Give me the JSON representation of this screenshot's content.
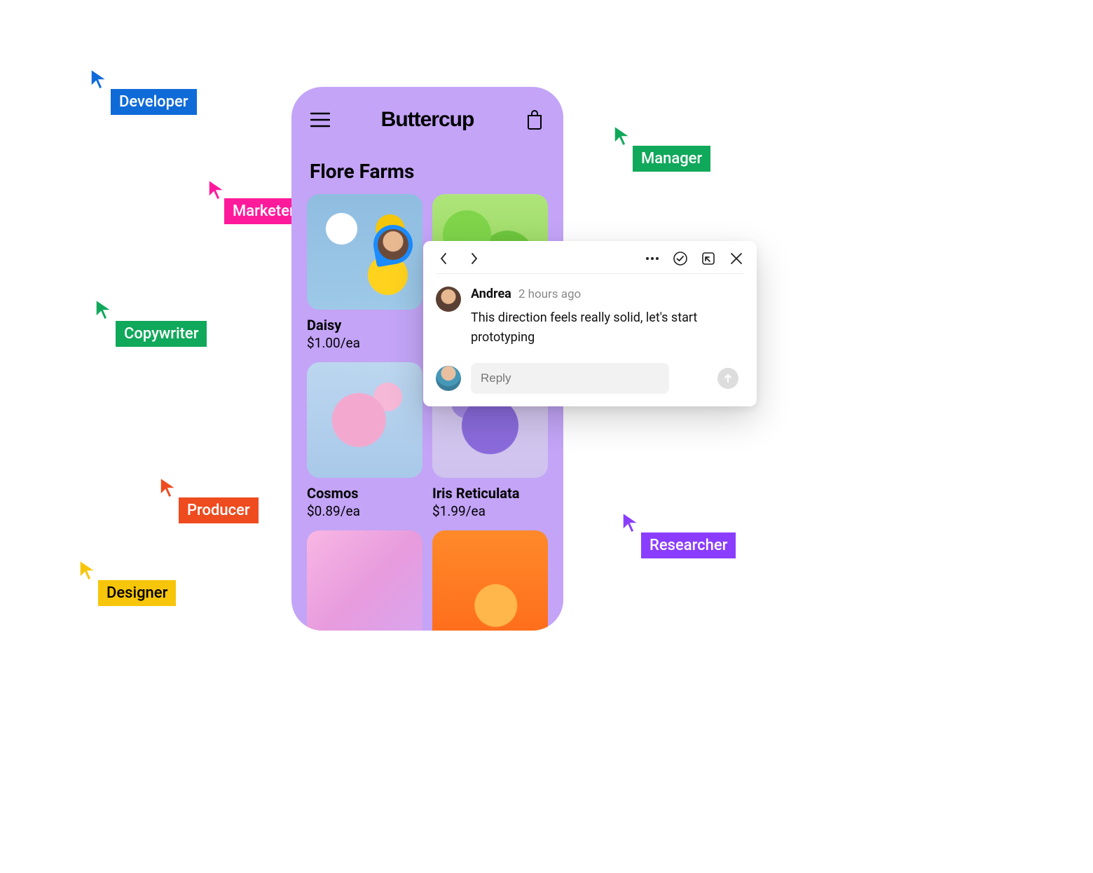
{
  "cursors": {
    "developer": {
      "label": "Developer",
      "color": "#0f6bd8"
    },
    "marketer": {
      "label": "Marketer",
      "color": "#ff1a9c"
    },
    "copywriter": {
      "label": "Copywriter",
      "color": "#10a85a"
    },
    "producer": {
      "label": "Producer",
      "color": "#ee4b1f"
    },
    "designer": {
      "label": "Designer",
      "color": "#f7c50a"
    },
    "manager": {
      "label": "Manager",
      "color": "#10a85a"
    },
    "researcher": {
      "label": "Researcher",
      "color": "#8b3dff"
    }
  },
  "phone": {
    "brand": "Buttercup",
    "section_title": "Flore Farms",
    "products": [
      {
        "name": "Daisy",
        "price": "$1.00/ea"
      },
      {
        "name": "",
        "price": ""
      },
      {
        "name": "Cosmos",
        "price": "$0.89/ea"
      },
      {
        "name": "Iris Reticulata",
        "price": "$1.99/ea"
      },
      {
        "name": "",
        "price": ""
      },
      {
        "name": "",
        "price": ""
      }
    ]
  },
  "comment": {
    "author": "Andrea",
    "timestamp": "2 hours ago",
    "body": "This direction feels really solid, let's start prototyping",
    "reply_placeholder": "Reply"
  }
}
